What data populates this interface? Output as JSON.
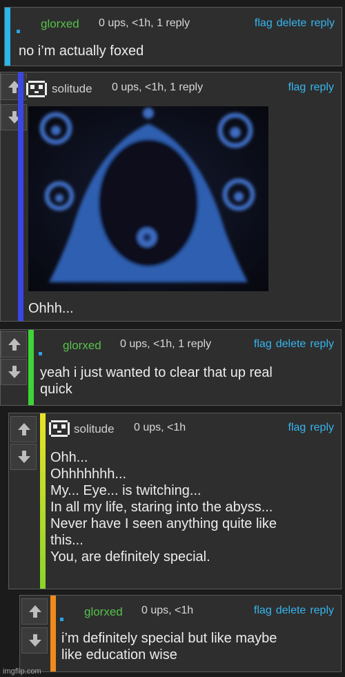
{
  "comments": [
    {
      "username": "glorxed",
      "meta": "0 ups, <1h, 1 reply",
      "flag": "flag",
      "delete": "delete",
      "reply": "reply",
      "body": "no i’m actually foxed",
      "stripe_color": "#29b6e8"
    },
    {
      "username": "solitude",
      "meta": "0 ups, <1h, 1 reply",
      "flag": "flag",
      "reply": "reply",
      "body": "Ohhh...",
      "stripe_color": "#3a46e6"
    },
    {
      "username": "glorxed",
      "meta": "0 ups, <1h, 1 reply",
      "flag": "flag",
      "delete": "delete",
      "reply": "reply",
      "body": "yeah i just wanted to clear that up real\nquick",
      "stripe_color": "#3fd33a"
    },
    {
      "username": "solitude",
      "meta": "0 ups, <1h",
      "flag": "flag",
      "reply": "reply",
      "body": "Ohh...\nOhhhhhhh...\nMy... Eye... is twitching...\nIn all my life, staring into the abyss...\nNever have I seen anything quite like\nthis...\nYou, are definitely special.",
      "stripe_color_top": "#e8e22a",
      "stripe_color_bottom": "#8ad42a"
    },
    {
      "username": "glorxed",
      "meta": "0 ups, <1h",
      "flag": "flag",
      "delete": "delete",
      "reply": "reply",
      "body": "i’m definitely special but like maybe\nlike education wise",
      "stripe_color": "#f08a1c"
    }
  ],
  "watermark": "imgflip.com",
  "colors": {
    "link": "#36b6f0",
    "username": "#56c24a"
  }
}
